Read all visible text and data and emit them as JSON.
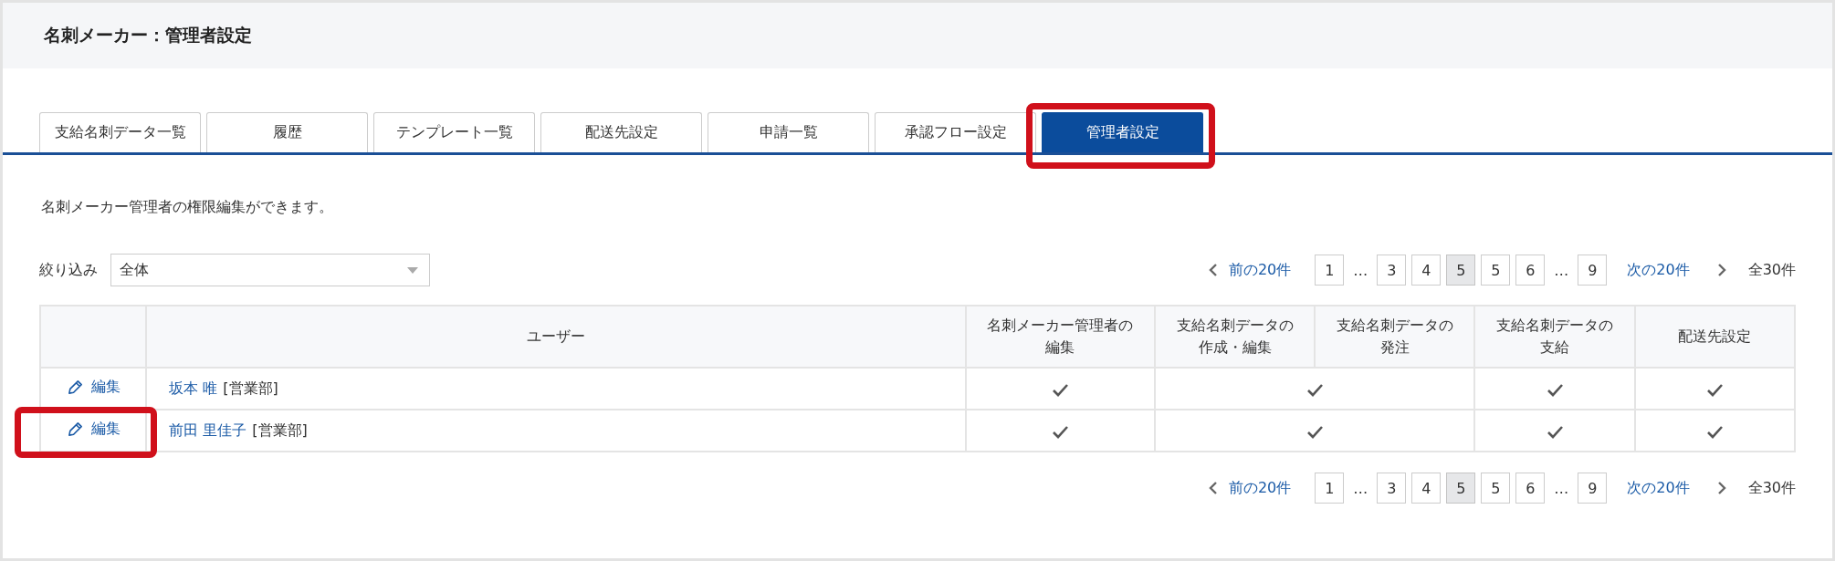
{
  "header": {
    "title": "名刺メーカー：管理者設定"
  },
  "tabs": [
    {
      "label": "支給名刺データ一覧",
      "selected": false,
      "highlighted": false
    },
    {
      "label": "履歴",
      "selected": false,
      "highlighted": false
    },
    {
      "label": "テンプレート一覧",
      "selected": false,
      "highlighted": false
    },
    {
      "label": "配送先設定",
      "selected": false,
      "highlighted": false
    },
    {
      "label": "申請一覧",
      "selected": false,
      "highlighted": false
    },
    {
      "label": "承認フロー設定",
      "selected": false,
      "highlighted": false
    },
    {
      "label": "管理者設定",
      "selected": true,
      "highlighted": true
    }
  ],
  "description": "名刺メーカー管理者の権限編集ができます。",
  "filter": {
    "label": "絞り込み",
    "value": "全体"
  },
  "pagination_top": {
    "prev": "前の20件",
    "next": "次の20件",
    "total": "全30件",
    "pages": [
      {
        "kind": "page",
        "label": "1",
        "selected": false
      },
      {
        "kind": "ellipsis",
        "label": "…"
      },
      {
        "kind": "page",
        "label": "3",
        "selected": false
      },
      {
        "kind": "page",
        "label": "4",
        "selected": false
      },
      {
        "kind": "page",
        "label": "5",
        "selected": true
      },
      {
        "kind": "page",
        "label": "5",
        "selected": false
      },
      {
        "kind": "page",
        "label": "6",
        "selected": false
      },
      {
        "kind": "ellipsis",
        "label": "…"
      },
      {
        "kind": "page",
        "label": "9",
        "selected": false
      }
    ]
  },
  "table": {
    "columns": [
      "",
      "ユーザー",
      "名刺メーカー管理者の編集",
      "支給名刺データの作成・編集",
      "支給名刺データの発注",
      "支給名刺データの支給",
      "配送先設定"
    ],
    "rows": [
      {
        "edit": "編集",
        "highlighted": false,
        "user": "坂本 唯",
        "department": "[営業部]",
        "permissions": [
          {
            "kind": "single",
            "checked": true
          },
          {
            "kind": "merged",
            "checked": true
          },
          {
            "kind": "single",
            "checked": true
          },
          {
            "kind": "single",
            "checked": true
          }
        ]
      },
      {
        "edit": "編集",
        "highlighted": true,
        "user": "前田 里佳子",
        "department": "[営業部]",
        "permissions": [
          {
            "kind": "single",
            "checked": true
          },
          {
            "kind": "merged",
            "checked": true
          },
          {
            "kind": "single",
            "checked": true
          },
          {
            "kind": "single",
            "checked": true
          }
        ]
      }
    ]
  },
  "pagination_bottom": {
    "prev": "前の20件",
    "next": "次の20件",
    "total": "全30件",
    "pages": [
      {
        "kind": "page",
        "label": "1",
        "selected": false
      },
      {
        "kind": "ellipsis",
        "label": "…"
      },
      {
        "kind": "page",
        "label": "3",
        "selected": false
      },
      {
        "kind": "page",
        "label": "4",
        "selected": false
      },
      {
        "kind": "page",
        "label": "5",
        "selected": true
      },
      {
        "kind": "page",
        "label": "5",
        "selected": false
      },
      {
        "kind": "page",
        "label": "6",
        "selected": false
      },
      {
        "kind": "ellipsis",
        "label": "…"
      },
      {
        "kind": "page",
        "label": "9",
        "selected": false
      }
    ]
  }
}
